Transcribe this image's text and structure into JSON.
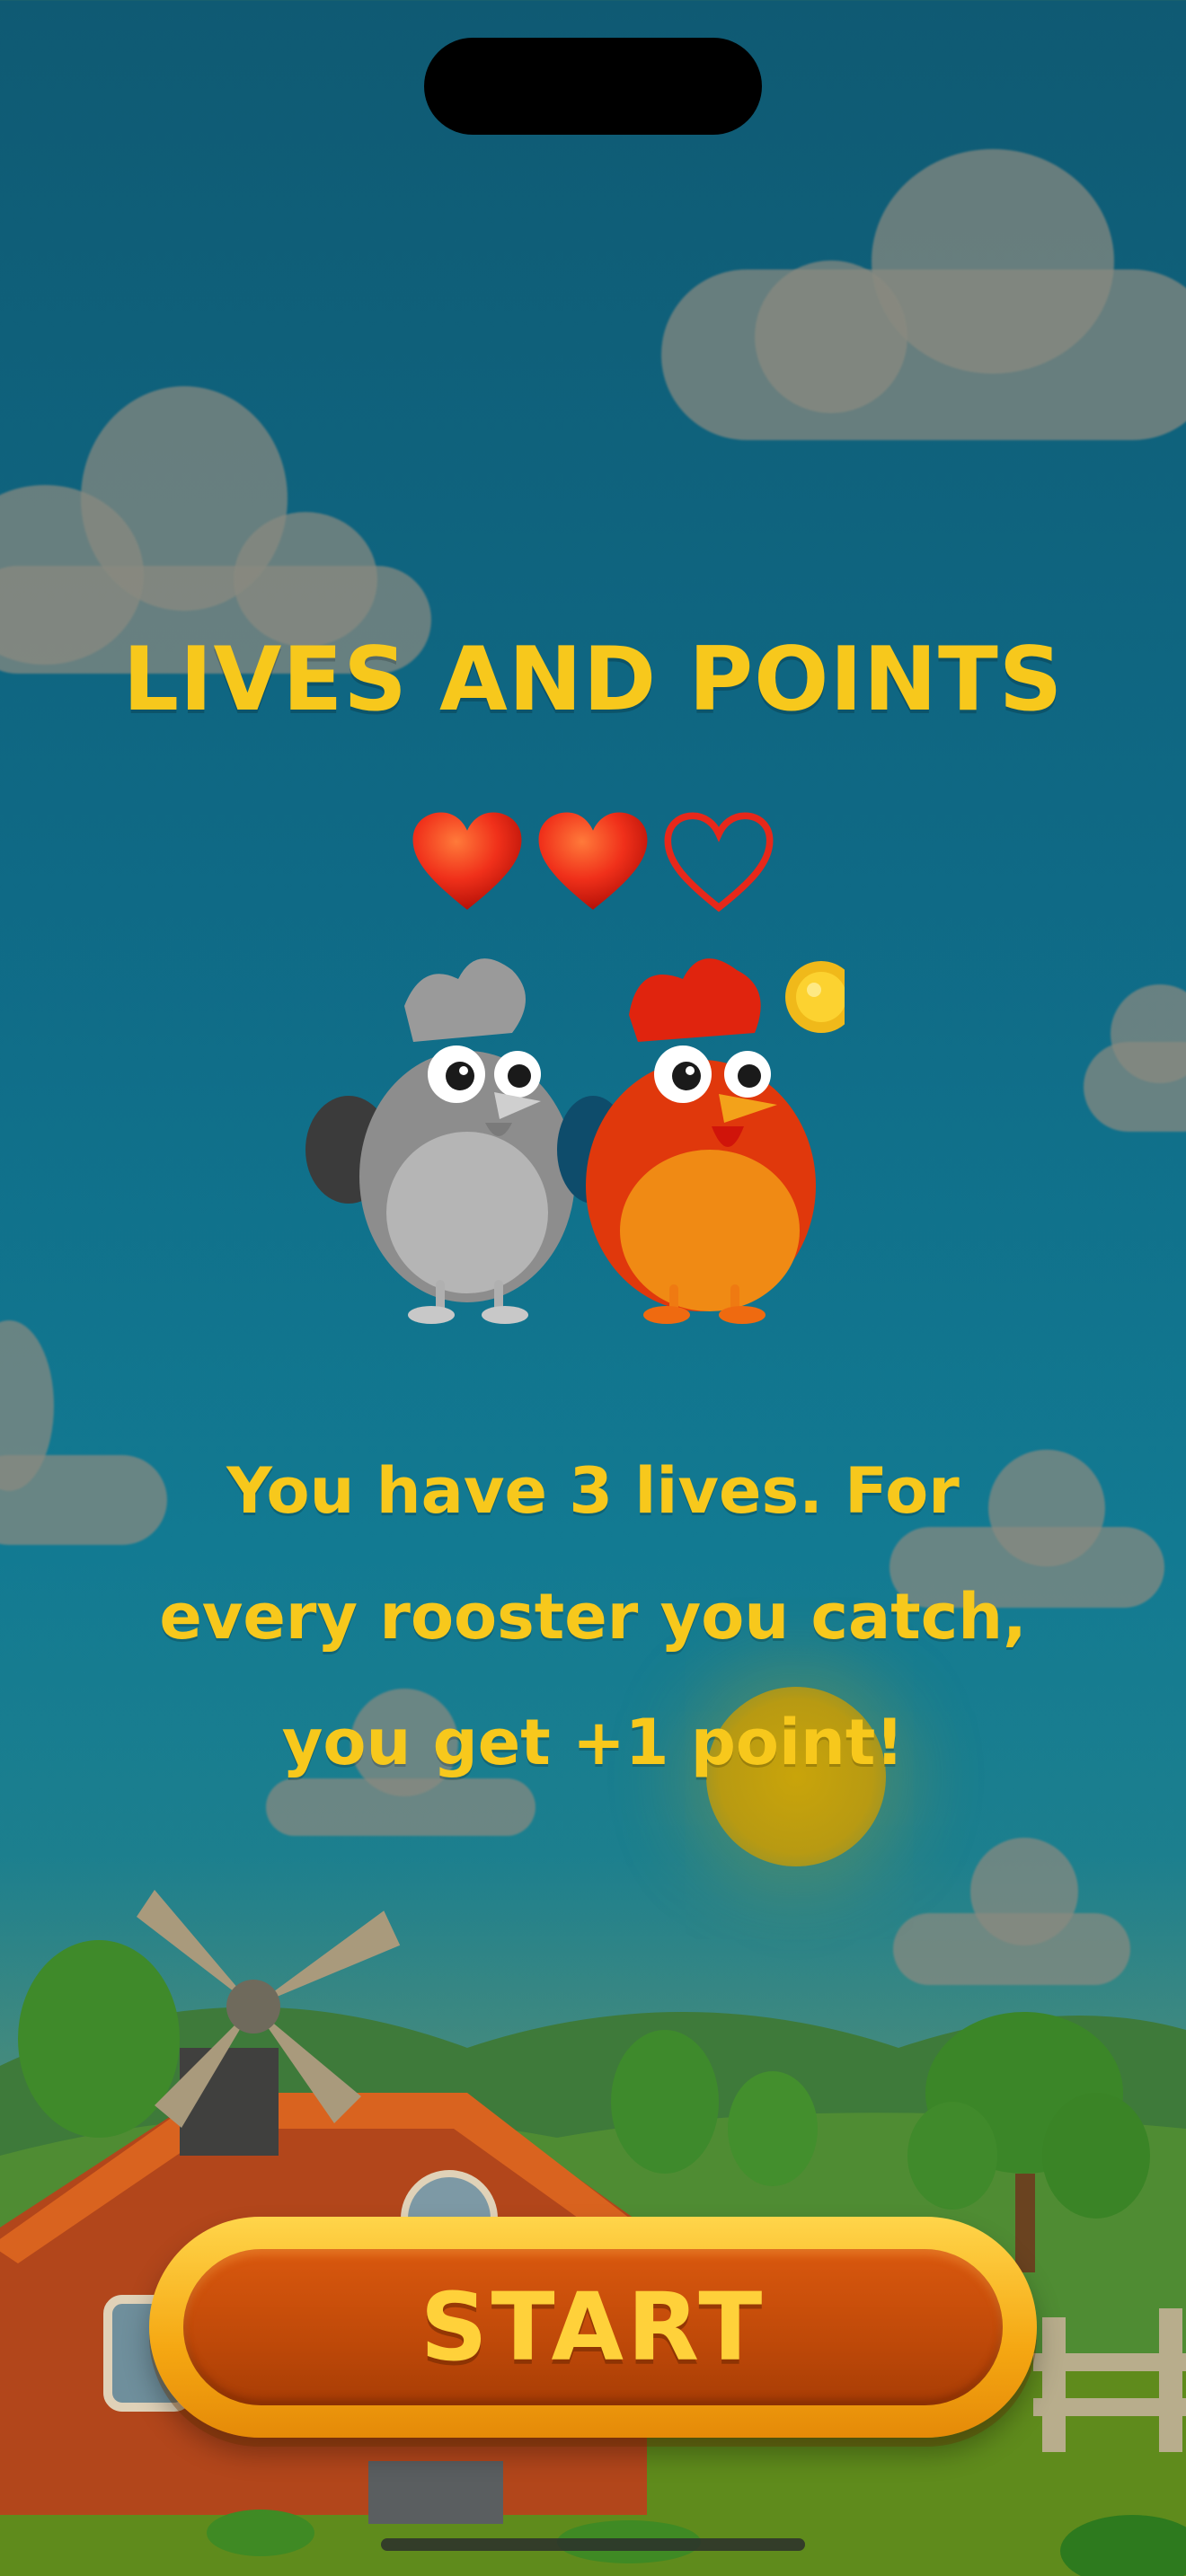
{
  "screen": {
    "title": "LIVES AND POINTS",
    "lives": {
      "total": 3,
      "filled": 2
    },
    "description_lines": [
      "You have 3 lives. For",
      "every rooster you catch,",
      "you get +1 point!"
    ],
    "start_label": "START"
  },
  "icons": {
    "heart_full": "heart-full-icon",
    "heart_empty": "heart-empty-icon",
    "coin": "coin-icon"
  },
  "colors": {
    "title": "#f7c81c",
    "heart": "#f0301a",
    "button_outer": "#f5a712",
    "button_inner": "#c14a09"
  }
}
